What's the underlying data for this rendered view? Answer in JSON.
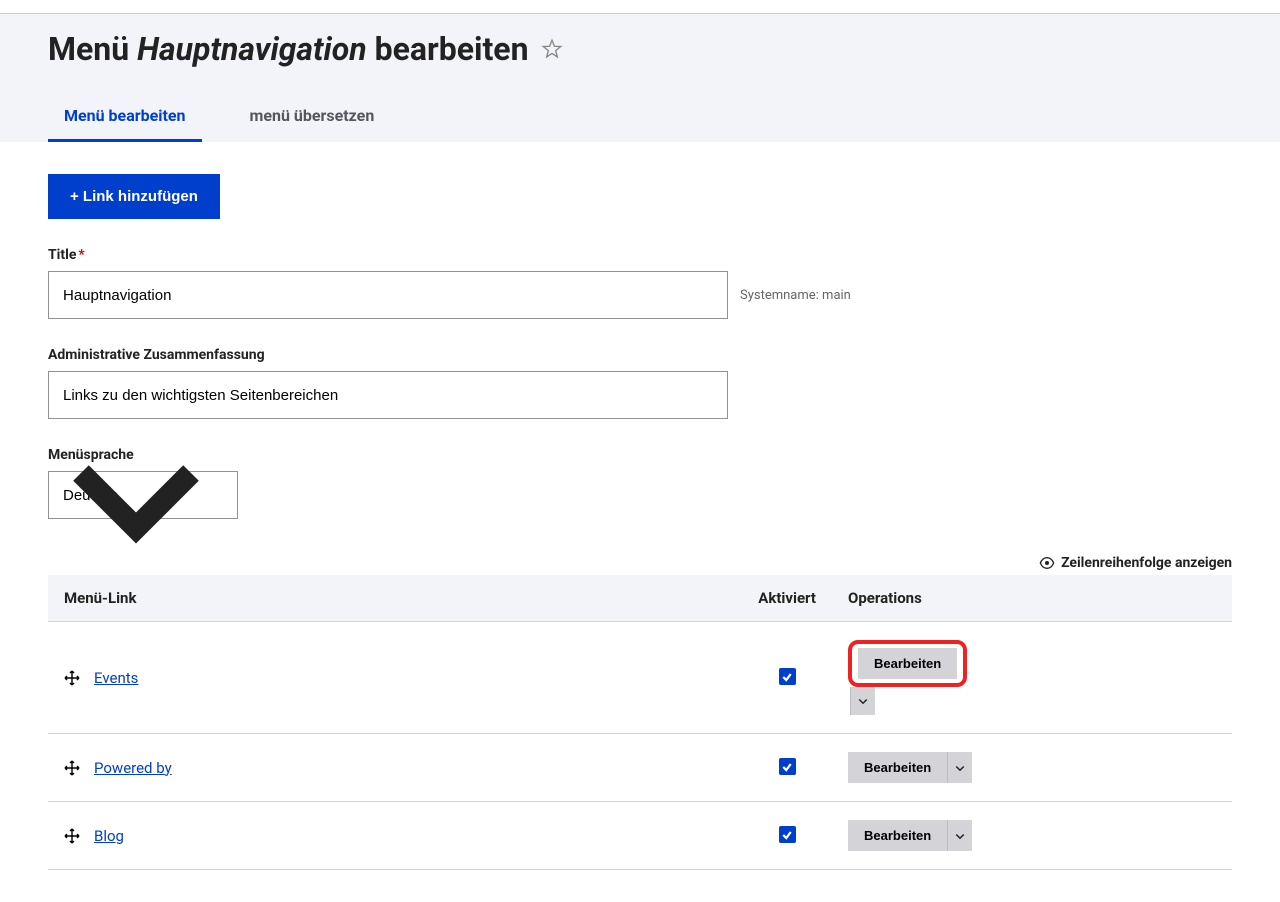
{
  "page_title_prefix": "Menü ",
  "page_title_em": "Hauptnavigation",
  "page_title_suffix": " bearbeiten",
  "tabs": {
    "edit": "Menü bearbeiten",
    "translate": "menü übersetzen"
  },
  "buttons": {
    "add_link": "+ Link hinzufügen"
  },
  "form": {
    "title_label": "Title",
    "title_value": "Hauptnavigation",
    "systemname_hint": "Systemname: main",
    "summary_label": "Administrative Zusammenfassung",
    "summary_value": "Links zu den wichtigsten Seitenbereichen",
    "language_label": "Menüsprache",
    "language_value": "Deutsch"
  },
  "table_toolbar": {
    "show_row_weights": "Zeilenreihenfolge anzeigen"
  },
  "table": {
    "headers": {
      "link": "Menü-Link",
      "enabled": "Aktiviert",
      "operations": "Operations"
    },
    "op_label": "Bearbeiten",
    "rows": [
      {
        "label": "Events",
        "enabled": true,
        "highlight": true
      },
      {
        "label": "Powered by",
        "enabled": true,
        "highlight": false
      },
      {
        "label": "Blog",
        "enabled": true,
        "highlight": false
      }
    ]
  }
}
